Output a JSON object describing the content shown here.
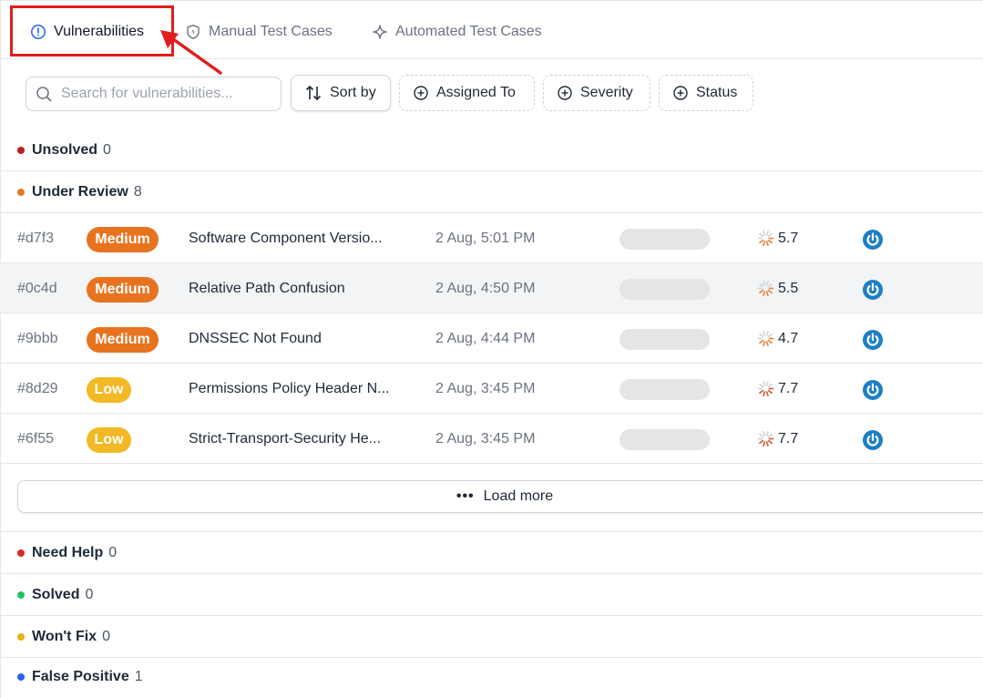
{
  "tabs": [
    {
      "label": "Vulnerabilities",
      "icon": "alert-circle-icon"
    },
    {
      "label": "Manual Test Cases",
      "icon": "shield-bolt-icon"
    },
    {
      "label": "Automated Test Cases",
      "icon": "sparkle-icon"
    }
  ],
  "toolbar": {
    "search_placeholder": "Search for vulnerabilities...",
    "sort_label": "Sort by",
    "filters": [
      "Assigned To",
      "Severity",
      "Status"
    ]
  },
  "groups": {
    "unsolved": {
      "name": "Unsolved",
      "count": "0",
      "color": "#b91c1c"
    },
    "under_review": {
      "name": "Under Review",
      "count": "8",
      "color": "#e07b24"
    },
    "need_help": {
      "name": "Need Help",
      "count": "0",
      "color": "#dc2626"
    },
    "solved": {
      "name": "Solved",
      "count": "0",
      "color": "#22c55e"
    },
    "wont_fix": {
      "name": "Won't Fix",
      "count": "0",
      "color": "#eab308"
    },
    "false_positive": {
      "name": "False Positive",
      "count": "1",
      "color": "#2563eb"
    }
  },
  "rows": [
    {
      "id": "#d7f3",
      "severity": "Medium",
      "title": "Software Component Versio...",
      "date": "2 Aug, 5:01 PM",
      "score": "5.7"
    },
    {
      "id": "#0c4d",
      "severity": "Medium",
      "title": "Relative Path Confusion",
      "date": "2 Aug, 4:50 PM",
      "score": "5.5"
    },
    {
      "id": "#9bbb",
      "severity": "Medium",
      "title": "DNSSEC Not Found",
      "date": "2 Aug, 4:44 PM",
      "score": "4.7"
    },
    {
      "id": "#8d29",
      "severity": "Low",
      "title": "Permissions Policy Header N...",
      "date": "2 Aug, 3:45 PM",
      "score": "7.7"
    },
    {
      "id": "#6f55",
      "severity": "Low",
      "title": "Strict-Transport-Security He...",
      "date": "2 Aug, 3:45 PM",
      "score": "7.7"
    }
  ],
  "load_more_label": "Load more",
  "colors": {
    "medium": "#e8731f",
    "low": "#f2b925",
    "accent": "#1d7fc4",
    "highlight": "#e11d1d"
  }
}
